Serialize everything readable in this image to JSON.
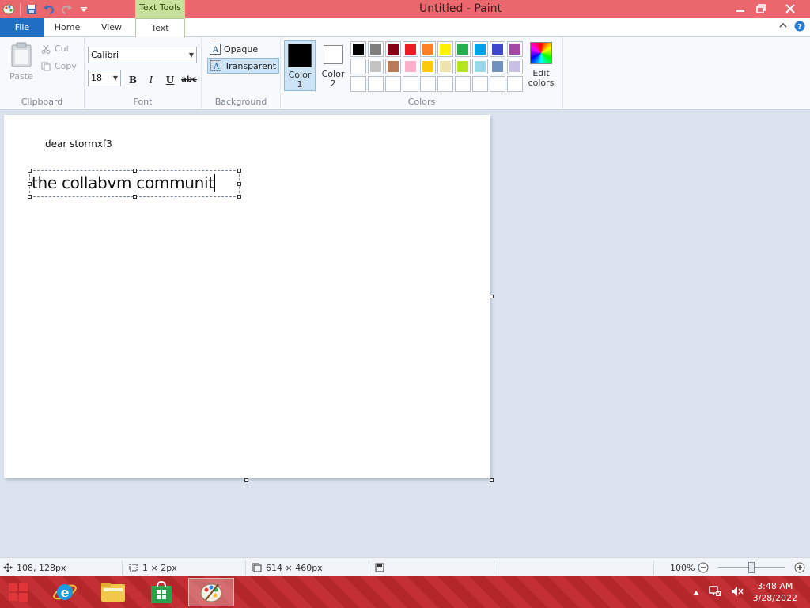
{
  "window": {
    "title": "Untitled - Paint",
    "contextual_tab": "Text Tools"
  },
  "tabs": {
    "file": "File",
    "home": "Home",
    "view": "View",
    "text": "Text"
  },
  "clipboard": {
    "paste": "Paste",
    "cut": "Cut",
    "copy": "Copy",
    "label": "Clipboard"
  },
  "font": {
    "family": "Calibri",
    "size": "18",
    "bold": "B",
    "italic": "I",
    "underline": "U",
    "strike": "abc",
    "label": "Font"
  },
  "background": {
    "opaque": "Opaque",
    "transparent": "Transparent",
    "label": "Background"
  },
  "colors": {
    "color1_label": "Color",
    "color1_num": "1",
    "color2_label": "Color",
    "color2_num": "2",
    "color1_value": "#000000",
    "color2_value": "#ffffff",
    "edit_label": "Edit",
    "edit_label2": "colors",
    "label": "Colors",
    "palette": [
      "#000000",
      "#7f7f7f",
      "#880015",
      "#ed1c24",
      "#ff7f27",
      "#fff200",
      "#22b14c",
      "#00a2e8",
      "#3f48cc",
      "#a349a4",
      "#ffffff",
      "#c3c3c3",
      "#b97a57",
      "#ffaec9",
      "#ffc90e",
      "#efe4b0",
      "#b5e61d",
      "#99d9ea",
      "#7092be",
      "#c8bfe7",
      "",
      "",
      "",
      "",
      "",
      "",
      "",
      "",
      "",
      ""
    ]
  },
  "canvas": {
    "line1": "dear stormxf3",
    "line2": "the collabvm communit"
  },
  "status": {
    "cursor_pos": "108, 128px",
    "selection_size": "1 × 2px",
    "image_size": "614 × 460px",
    "zoom": "100%"
  },
  "taskbar": {
    "time": "3:48 AM",
    "date": "3/28/2022"
  }
}
